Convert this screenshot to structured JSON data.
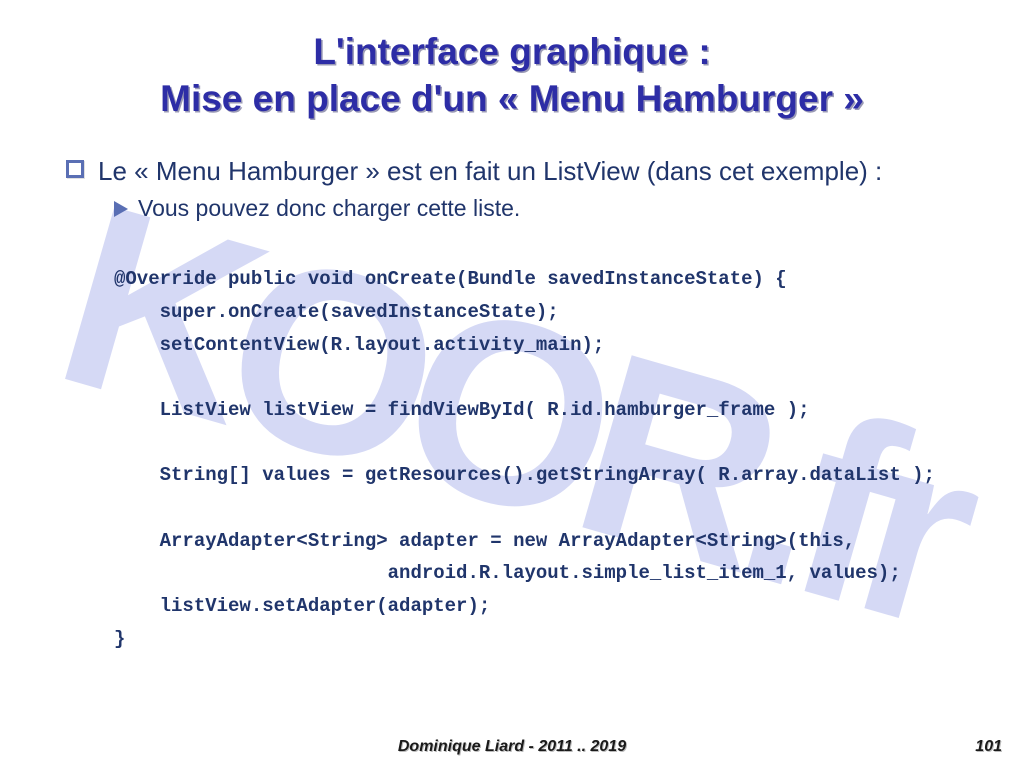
{
  "watermark": "KOOR.fr",
  "title_line1": "L'interface graphique :",
  "title_line2": "Mise en place d'un « Menu Hamburger »",
  "bullet": "Le « Menu Hamburger » est en fait un ListView (dans cet exemple) :",
  "subbullet": "Vous pouvez donc charger cette liste.",
  "code": "@Override public void onCreate(Bundle savedInstanceState) {\n    super.onCreate(savedInstanceState);\n    setContentView(R.layout.activity_main);\n\n    ListView listView = findViewById( R.id.hamburger_frame );\n\n    String[] values = getResources().getStringArray( R.array.dataList );\n\n    ArrayAdapter<String> adapter = new ArrayAdapter<String>(this,\n                        android.R.layout.simple_list_item_1, values);\n    listView.setAdapter(adapter);\n}",
  "footer_author": "Dominique Liard - 2011 .. 2019",
  "footer_page": "101"
}
